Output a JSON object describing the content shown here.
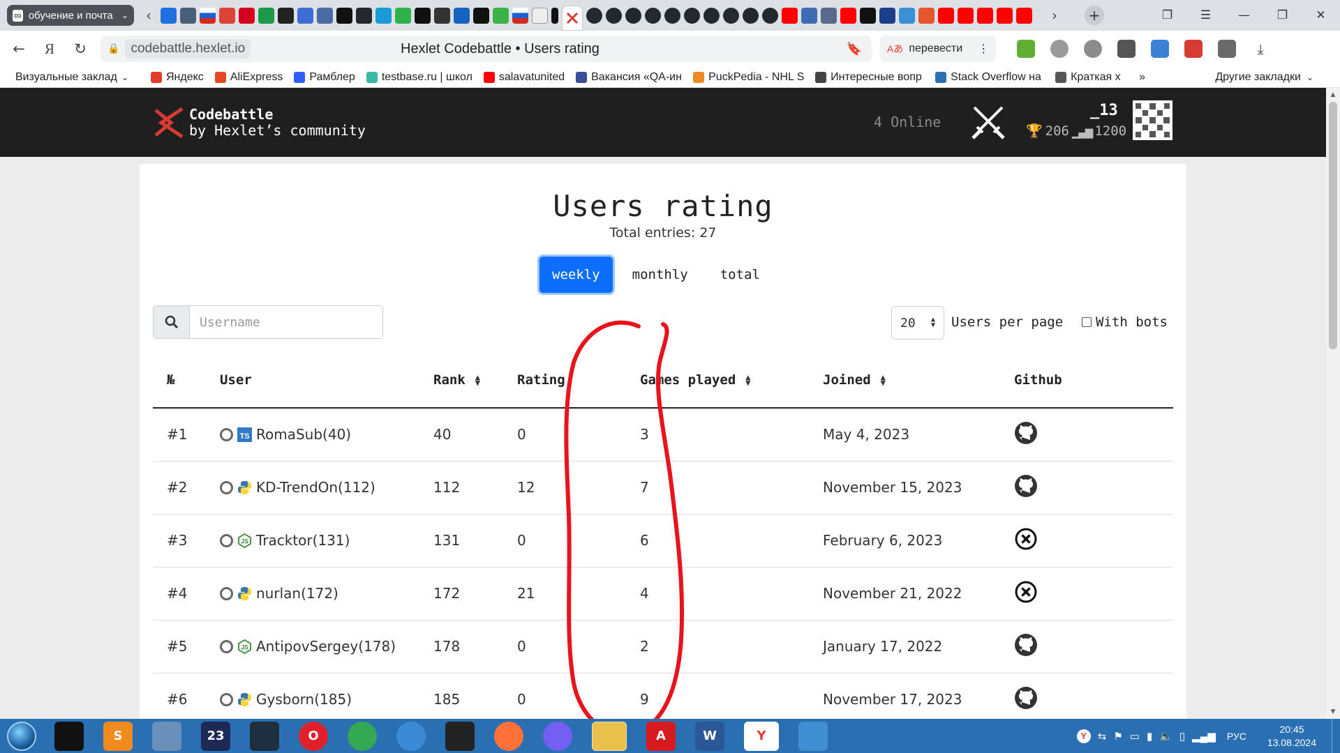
{
  "browser": {
    "group_tab_label": "обучение и почта",
    "url_host": "codebattle.hexlet.io",
    "page_title": "Hexlet Codebattle • Users rating",
    "translate_label": "перевести"
  },
  "bookmarks": {
    "items": [
      {
        "label": "Визуальные заклад",
        "color": "#888888"
      },
      {
        "label": "Яндекс",
        "color": "#e33b2e"
      },
      {
        "label": "AliExpress",
        "color": "#e44a22"
      },
      {
        "label": "Рамблер",
        "color": "#315efb"
      },
      {
        "label": "testbase.ru | школ",
        "color": "#3ab9a6"
      },
      {
        "label": "salavatunited",
        "color": "#ff0000"
      },
      {
        "label": "Вакансия «QA-ин",
        "color": "#3b4e9a"
      },
      {
        "label": "PuckPedia - NHL S",
        "color": "#f08a24"
      },
      {
        "label": "Интересные вопр",
        "color": "#444444"
      },
      {
        "label": "Stack Overflow на",
        "color": "#2b6fb3"
      },
      {
        "label": "Краткая х",
        "color": "#555555"
      }
    ],
    "more_label": "»",
    "other_label": "Другие закладки"
  },
  "header": {
    "logo_line1": "Codebattle",
    "logo_line2": "by Hexlet’s community",
    "online": "4 Online",
    "username": "_13",
    "games": "206",
    "rating": "1200"
  },
  "main": {
    "title": "Users rating",
    "total_entries": "Total entries: 27",
    "tabs": [
      {
        "label": "weekly",
        "active": true
      },
      {
        "label": "monthly",
        "active": false
      },
      {
        "label": "total",
        "active": false
      }
    ],
    "search_placeholder": "Username",
    "per_page_value": "20",
    "per_page_label": "Users per page",
    "with_bots_label": "With bots",
    "columns": [
      "№",
      "User",
      "Rank",
      "Rating",
      "Games played",
      "Joined",
      "Github"
    ],
    "rows": [
      {
        "num": "#1",
        "user": "RomaSub(40)",
        "lang": "ts",
        "rank": "40",
        "rating": "0",
        "games": "3",
        "joined": "May 4, 2023",
        "github": "github"
      },
      {
        "num": "#2",
        "user": "KD-TrendOn(112)",
        "lang": "python",
        "rank": "112",
        "rating": "12",
        "games": "7",
        "joined": "November 15, 2023",
        "github": "github"
      },
      {
        "num": "#3",
        "user": "Tracktor(131)",
        "lang": "js",
        "rank": "131",
        "rating": "0",
        "games": "6",
        "joined": "February 6, 2023",
        "github": "none"
      },
      {
        "num": "#4",
        "user": "nurlan(172)",
        "lang": "python",
        "rank": "172",
        "rating": "21",
        "games": "4",
        "joined": "November 21, 2022",
        "github": "none"
      },
      {
        "num": "#5",
        "user": "AntipovSergey(178)",
        "lang": "js",
        "rank": "178",
        "rating": "0",
        "games": "2",
        "joined": "January 17, 2022",
        "github": "github"
      },
      {
        "num": "#6",
        "user": "Gysborn(185)",
        "lang": "python",
        "rank": "185",
        "rating": "0",
        "games": "9",
        "joined": "November 17, 2023",
        "github": "github"
      }
    ]
  },
  "taskbar": {
    "apps": [
      {
        "icon": "terminal-icon",
        "color": "#111111",
        "text": ""
      },
      {
        "icon": "sublime-text-icon",
        "color": "#f28b1e",
        "text": "S"
      },
      {
        "icon": "file-manager-icon",
        "color": "#6a8fb8",
        "text": ""
      },
      {
        "icon": "app-23-icon",
        "color": "#1e2a55",
        "text": "23"
      },
      {
        "icon": "mysql-icon",
        "color": "#1f2f3f",
        "text": ""
      },
      {
        "icon": "opera-icon",
        "color": "#e0202a",
        "text": "O"
      },
      {
        "icon": "chrome-icon",
        "color": "#35a853",
        "text": ""
      },
      {
        "icon": "safari-icon",
        "color": "#3c89d6",
        "text": ""
      },
      {
        "icon": "github-desktop-icon",
        "color": "#222222",
        "text": ""
      },
      {
        "icon": "firefox-icon",
        "color": "#ff7139",
        "text": ""
      },
      {
        "icon": "viber-icon",
        "color": "#7360f2",
        "text": ""
      },
      {
        "icon": "explorer-icon",
        "color": "#e8c04a",
        "text": ""
      },
      {
        "icon": "acrobat-icon",
        "color": "#d71920",
        "text": "A"
      },
      {
        "icon": "word-icon",
        "color": "#2b5797",
        "text": "W"
      },
      {
        "icon": "yandex-browser-icon",
        "color": "#ffffff",
        "text": "Y"
      },
      {
        "icon": "photos-icon",
        "color": "#3f8fd2",
        "text": ""
      }
    ],
    "language": "РУС",
    "time": "20:45",
    "date": "13.08.2024"
  },
  "colors": {
    "accent": "#0d6efd",
    "header_bg": "#1f1f1f",
    "annotation": "#e8141c",
    "logo_red": "#d63b34"
  }
}
